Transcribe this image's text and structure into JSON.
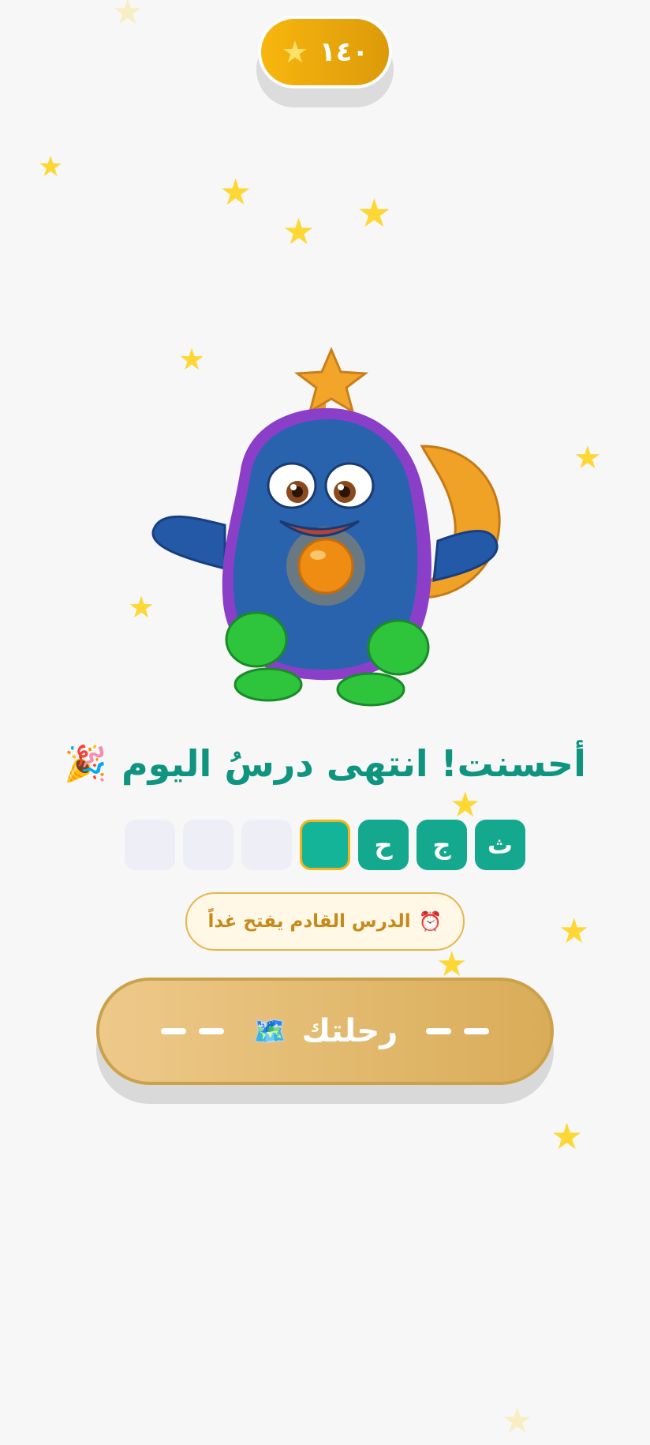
{
  "score": {
    "value": "١٤٠",
    "icon": "star-icon"
  },
  "headline": {
    "text": "أحسنت! انتهى درسُ اليوم",
    "emoji": "🎉"
  },
  "progress_tiles": [
    {
      "label": "ث",
      "state": "done"
    },
    {
      "label": "ج",
      "state": "done"
    },
    {
      "label": "ح",
      "state": "done"
    },
    {
      "label": "",
      "state": "current"
    },
    {
      "label": "",
      "state": "empty"
    },
    {
      "label": "",
      "state": "empty"
    },
    {
      "label": "",
      "state": "empty"
    }
  ],
  "notice": {
    "icon": "⏰",
    "text": "الدرس القادم يفتح غداً"
  },
  "journey_button": {
    "label": "رحلتك",
    "icon": "🗺️"
  },
  "colors": {
    "accent": "#0f9480",
    "gold": "#f8b60e",
    "button": "#e2b86a"
  }
}
